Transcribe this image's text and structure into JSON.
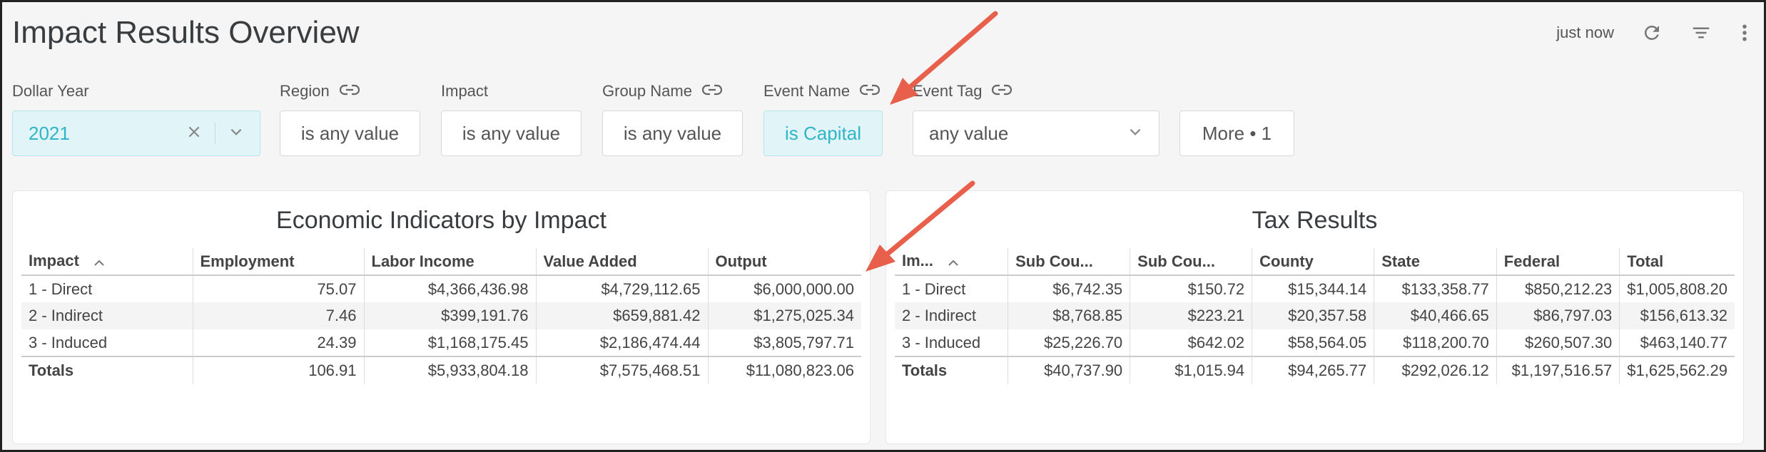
{
  "header": {
    "title": "Impact Results Overview",
    "updated": "just now",
    "icons": [
      "refresh-icon",
      "filter-icon",
      "more-vertical-icon"
    ]
  },
  "filters": {
    "dollar_year": {
      "label": "Dollar Year",
      "value": "2021"
    },
    "region": {
      "label": "Region",
      "value": "is any value"
    },
    "impact": {
      "label": "Impact",
      "value": "is any value"
    },
    "group_name": {
      "label": "Group Name",
      "value": "is any value"
    },
    "event_name": {
      "label": "Event Name",
      "value": "is Capital"
    },
    "event_tag": {
      "label": "Event Tag",
      "value": "any value"
    },
    "more": {
      "label": "More • 1"
    }
  },
  "econ": {
    "title": "Economic Indicators by Impact",
    "headers": [
      "Impact",
      "Employment",
      "Labor Income",
      "Value Added",
      "Output"
    ],
    "rows": [
      [
        "1 - Direct",
        "75.07",
        "$4,366,436.98",
        "$4,729,112.65",
        "$6,000,000.00"
      ],
      [
        "2 - Indirect",
        "7.46",
        "$399,191.76",
        "$659,881.42",
        "$1,275,025.34"
      ],
      [
        "3 - Induced",
        "24.39",
        "$1,168,175.45",
        "$2,186,474.44",
        "$3,805,797.71"
      ]
    ],
    "totals": [
      "Totals",
      "106.91",
      "$5,933,804.18",
      "$7,575,468.51",
      "$11,080,823.06"
    ]
  },
  "tax": {
    "title": "Tax Results",
    "headers": [
      "Im...",
      "Sub Cou...",
      "Sub Cou...",
      "County",
      "State",
      "Federal",
      "Total"
    ],
    "rows": [
      [
        "1 - Direct",
        "$6,742.35",
        "$150.72",
        "$15,344.14",
        "$133,358.77",
        "$850,212.23",
        "$1,005,808.20"
      ],
      [
        "2 - Indirect",
        "$8,768.85",
        "$223.21",
        "$20,357.58",
        "$40,466.65",
        "$86,797.03",
        "$156,613.32"
      ],
      [
        "3 - Induced",
        "$25,226.70",
        "$642.02",
        "$58,564.05",
        "$118,200.70",
        "$260,507.30",
        "$463,140.77"
      ]
    ],
    "totals": [
      "Totals",
      "$40,737.90",
      "$1,015.94",
      "$94,265.77",
      "$292,026.12",
      "$1,197,516.57",
      "$1,625,562.29"
    ]
  },
  "colors": {
    "accent": "#2fb5c7",
    "arrow": "#e8604c"
  }
}
